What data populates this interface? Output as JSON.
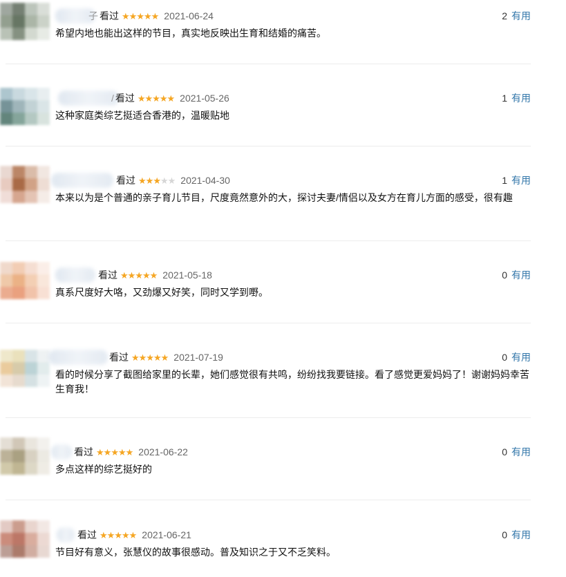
{
  "colors": {
    "star_on": "#f5a623",
    "star_off": "#d6d6d6",
    "link": "#3377aa",
    "date": "#666666"
  },
  "labels": {
    "watched": "看过",
    "useful": "有用"
  },
  "comments": [
    {
      "partial_name": "子",
      "date": "2021-06-24",
      "rating": 5,
      "votes": "2",
      "text": "希望内地也能出这样的节目，真实地反映出生育和结婚的痛苦。"
    },
    {
      "partial_name": "/",
      "date": "2021-05-26",
      "rating": 5,
      "votes": "1",
      "text": "这种家庭类综艺挺适合香港的，温暖贴地"
    },
    {
      "partial_name": "",
      "date": "2021-04-30",
      "rating": 3,
      "votes": "1",
      "text": "本来以为是个普通的亲子育儿节目，尺度竟然意外的大，探讨夫妻/情侣以及女方在育儿方面的感受，很有趣"
    },
    {
      "partial_name": "",
      "date": "2021-05-18",
      "rating": 5,
      "votes": "0",
      "text": "真系尺度好大咯，又劲爆又好笑，同时又学到嘢。"
    },
    {
      "partial_name": "",
      "date": "2021-07-19",
      "rating": 5,
      "votes": "0",
      "text": "看的时候分享了截图给家里的长辈，她们感觉很有共鸣，纷纷找我要链接。看了感觉更爱妈妈了！谢谢妈妈幸苦生育我！"
    },
    {
      "partial_name": "",
      "date": "2021-06-22",
      "rating": 5,
      "votes": "0",
      "text": "多点这样的综艺挺好的"
    },
    {
      "partial_name": "",
      "date": "2021-06-21",
      "rating": 5,
      "votes": "0",
      "text": "节目好有意义，张慧仪的故事很感动。普及知识之于又不乏笑料。"
    }
  ]
}
